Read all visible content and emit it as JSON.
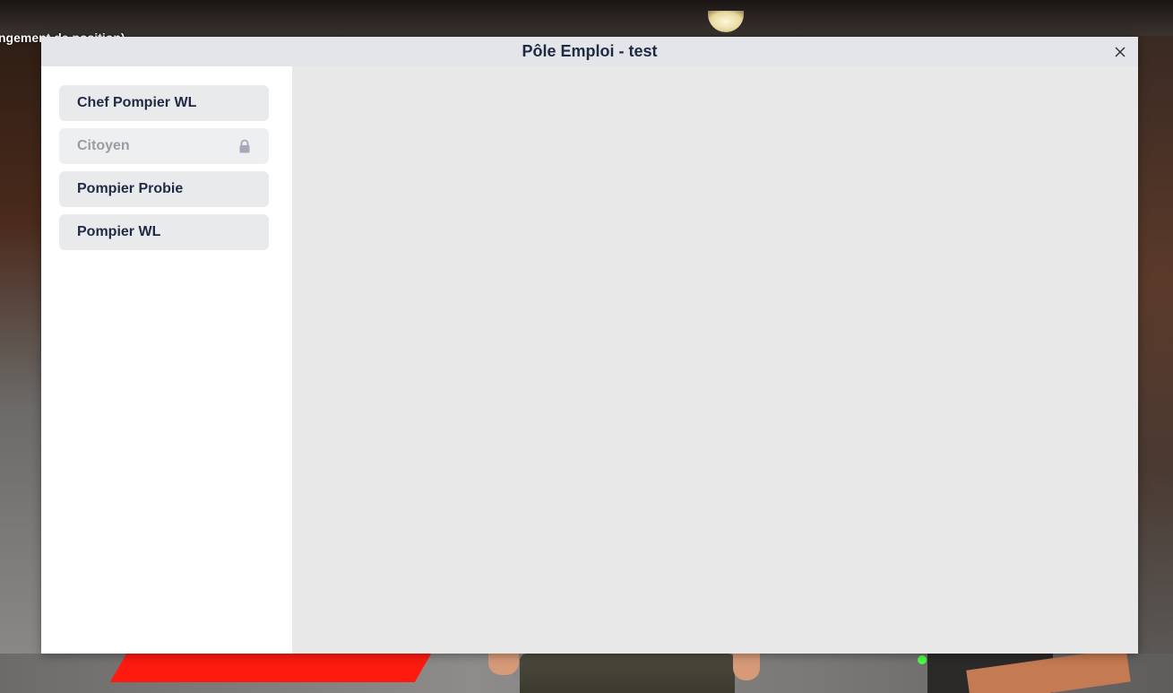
{
  "hud": {
    "partial_text": "ngement de position)"
  },
  "window": {
    "title": "Pôle Emploi - test",
    "close_icon": "close-icon"
  },
  "sidebar": {
    "jobs": [
      {
        "label": "Chef Pompier WL",
        "locked": false
      },
      {
        "label": "Citoyen",
        "locked": true,
        "icon": "lock-icon"
      },
      {
        "label": "Pompier Probie",
        "locked": false
      },
      {
        "label": "Pompier WL",
        "locked": false
      }
    ]
  },
  "colors": {
    "title_text": "#1f2a44",
    "titlebar_bg": "#e4e5e9",
    "job_bg": "#e9eaec",
    "locked_text": "#9a9ca3",
    "content_bg": "#e8e8e8"
  }
}
